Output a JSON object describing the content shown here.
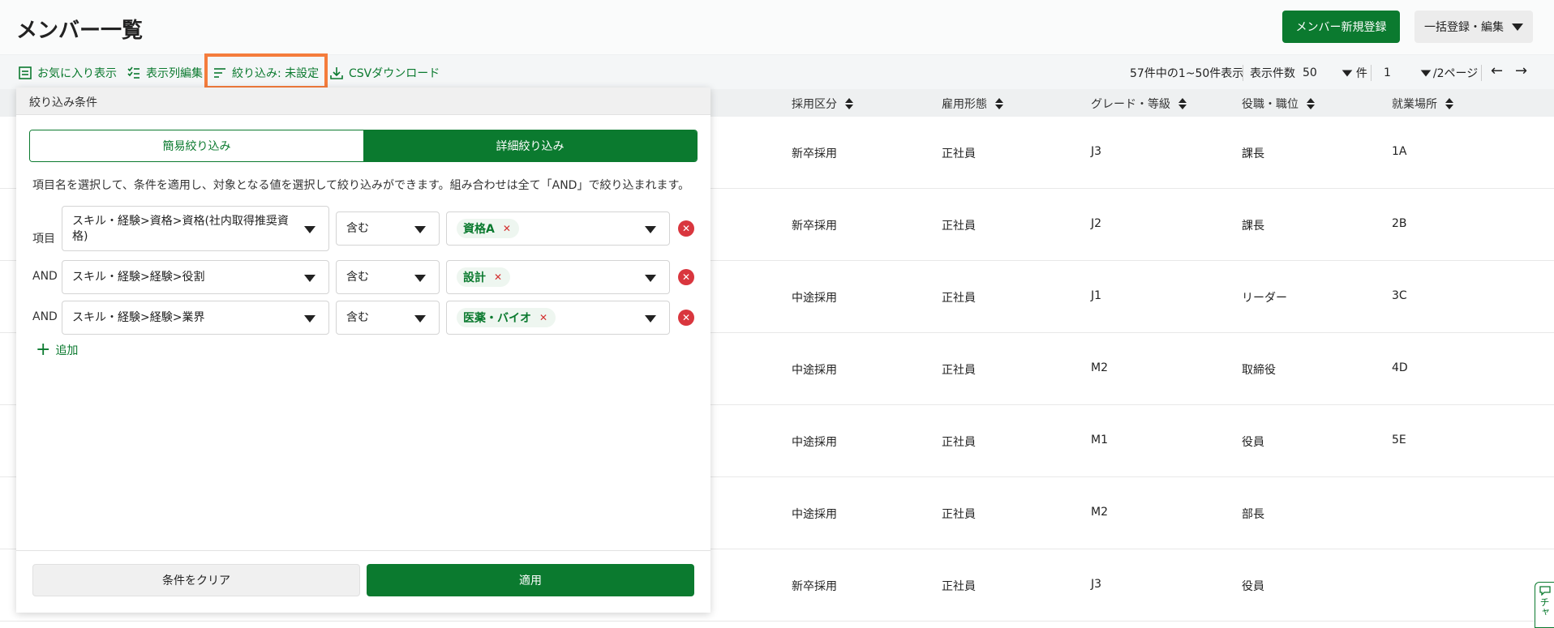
{
  "header": {
    "title": "メンバー一覧",
    "new_button": "メンバー新規登録",
    "bulk_button": "一括登録・編集"
  },
  "toolbar": {
    "favorites": "お気に入り表示",
    "columns": "表示列編集",
    "filter": "絞り込み: 未設定",
    "csv": "CSVダウンロード"
  },
  "pager": {
    "summary": "57件中の1~50件表示",
    "per_page_label": "表示件数",
    "per_page_value": "50",
    "per_page_unit": "件",
    "page_value": "1",
    "page_total": "/2ページ"
  },
  "table": {
    "headers": [
      "採用区分",
      "雇用形態",
      "グレード・等級",
      "役職・職位",
      "就業場所"
    ],
    "rows": [
      [
        "新卒採用",
        "正社員",
        "J3",
        "課長",
        "1A"
      ],
      [
        "新卒採用",
        "正社員",
        "J2",
        "課長",
        "2B"
      ],
      [
        "中途採用",
        "正社員",
        "J1",
        "リーダー",
        "3C"
      ],
      [
        "中途採用",
        "正社員",
        "M2",
        "取締役",
        "4D"
      ],
      [
        "中途採用",
        "正社員",
        "M1",
        "役員",
        "5E"
      ],
      [
        "中途採用",
        "正社員",
        "M2",
        "部長",
        ""
      ],
      [
        "新卒採用",
        "正社員",
        "J3",
        "役員",
        ""
      ]
    ]
  },
  "filter_panel": {
    "title": "絞り込み条件",
    "tab_simple": "簡易絞り込み",
    "tab_detail": "詳細絞り込み",
    "description": "項目名を選択して、条件を適用し、対象となる値を選択して絞り込みができます。組み合わせは全て「AND」で絞り込まれます。",
    "conditions": [
      {
        "label": "項目",
        "field_line1": "スキル・経験>資格>資格(社内取得推奨資",
        "field_line2": "格)",
        "operator": "含む",
        "value": "資格A"
      },
      {
        "label": "AND",
        "field_line1": "スキル・経験>経験>役割",
        "field_line2": "",
        "operator": "含む",
        "value": "設計"
      },
      {
        "label": "AND",
        "field_line1": "スキル・経験>経験>業界",
        "field_line2": "",
        "operator": "含む",
        "value": "医薬・バイオ"
      }
    ],
    "add_label": "追加",
    "clear_button": "条件をクリア",
    "apply_button": "適用"
  },
  "chat": {
    "icon": "chat-icon",
    "label": "チャ"
  },
  "colors": {
    "accent": "#0b7a2f",
    "highlight": "#f47c3c",
    "danger": "#d9363e"
  }
}
